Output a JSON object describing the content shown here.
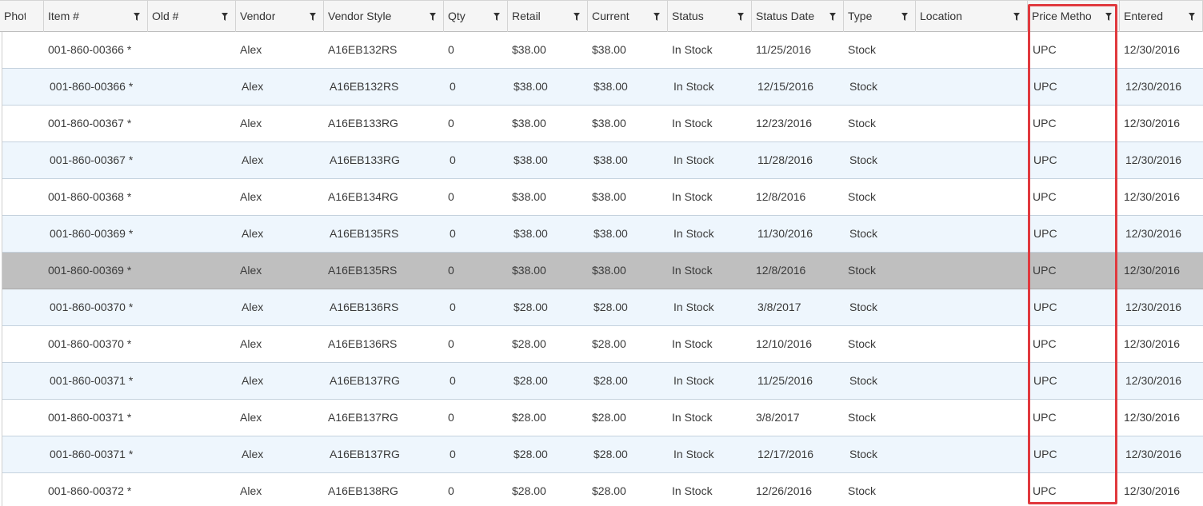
{
  "columns": [
    {
      "key": "photo",
      "label": "Photo",
      "filter": false
    },
    {
      "key": "item",
      "label": "Item #",
      "filter": true
    },
    {
      "key": "old",
      "label": "Old #",
      "filter": true
    },
    {
      "key": "vendor",
      "label": "Vendor",
      "filter": true
    },
    {
      "key": "vendor_style",
      "label": "Vendor Style",
      "filter": true
    },
    {
      "key": "qty",
      "label": "Qty",
      "filter": true
    },
    {
      "key": "retail",
      "label": "Retail",
      "filter": true
    },
    {
      "key": "current",
      "label": "Current",
      "filter": true
    },
    {
      "key": "status",
      "label": "Status",
      "filter": true
    },
    {
      "key": "status_date",
      "label": "Status Date",
      "filter": true
    },
    {
      "key": "type",
      "label": "Type",
      "filter": true
    },
    {
      "key": "location",
      "label": "Location",
      "filter": true
    },
    {
      "key": "price_method",
      "label": "Price Metho",
      "filter": true
    },
    {
      "key": "entered",
      "label": "Entered",
      "filter": true
    }
  ],
  "rows": [
    {
      "item": "001-860-00366 *",
      "vendor": "Alex",
      "vendor_style": "A16EB132RS",
      "qty": "0",
      "retail": "$38.00",
      "current": "$38.00",
      "status": "In Stock",
      "status_date": "11/25/2016",
      "type": "Stock",
      "price_method": "UPC",
      "entered": "12/30/2016",
      "selected": false
    },
    {
      "item": "001-860-00366 *",
      "vendor": "Alex",
      "vendor_style": "A16EB132RS",
      "qty": "0",
      "retail": "$38.00",
      "current": "$38.00",
      "status": "In Stock",
      "status_date": "12/15/2016",
      "type": "Stock",
      "price_method": "UPC",
      "entered": "12/30/2016",
      "selected": false
    },
    {
      "item": "001-860-00367 *",
      "vendor": "Alex",
      "vendor_style": "A16EB133RG",
      "qty": "0",
      "retail": "$38.00",
      "current": "$38.00",
      "status": "In Stock",
      "status_date": "12/23/2016",
      "type": "Stock",
      "price_method": "UPC",
      "entered": "12/30/2016",
      "selected": false
    },
    {
      "item": "001-860-00367 *",
      "vendor": "Alex",
      "vendor_style": "A16EB133RG",
      "qty": "0",
      "retail": "$38.00",
      "current": "$38.00",
      "status": "In Stock",
      "status_date": "11/28/2016",
      "type": "Stock",
      "price_method": "UPC",
      "entered": "12/30/2016",
      "selected": false
    },
    {
      "item": "001-860-00368 *",
      "vendor": "Alex",
      "vendor_style": "A16EB134RG",
      "qty": "0",
      "retail": "$38.00",
      "current": "$38.00",
      "status": "In Stock",
      "status_date": "12/8/2016",
      "type": "Stock",
      "price_method": "UPC",
      "entered": "12/30/2016",
      "selected": false
    },
    {
      "item": "001-860-00369 *",
      "vendor": "Alex",
      "vendor_style": "A16EB135RS",
      "qty": "0",
      "retail": "$38.00",
      "current": "$38.00",
      "status": "In Stock",
      "status_date": "11/30/2016",
      "type": "Stock",
      "price_method": "UPC",
      "entered": "12/30/2016",
      "selected": false
    },
    {
      "item": "001-860-00369 *",
      "vendor": "Alex",
      "vendor_style": "A16EB135RS",
      "qty": "0",
      "retail": "$38.00",
      "current": "$38.00",
      "status": "In Stock",
      "status_date": "12/8/2016",
      "type": "Stock",
      "price_method": "UPC",
      "entered": "12/30/2016",
      "selected": true
    },
    {
      "item": "001-860-00370 *",
      "vendor": "Alex",
      "vendor_style": "A16EB136RS",
      "qty": "0",
      "retail": "$28.00",
      "current": "$28.00",
      "status": "In Stock",
      "status_date": "3/8/2017",
      "type": "Stock",
      "price_method": "UPC",
      "entered": "12/30/2016",
      "selected": false
    },
    {
      "item": "001-860-00370 *",
      "vendor": "Alex",
      "vendor_style": "A16EB136RS",
      "qty": "0",
      "retail": "$28.00",
      "current": "$28.00",
      "status": "In Stock",
      "status_date": "12/10/2016",
      "type": "Stock",
      "price_method": "UPC",
      "entered": "12/30/2016",
      "selected": false
    },
    {
      "item": "001-860-00371 *",
      "vendor": "Alex",
      "vendor_style": "A16EB137RG",
      "qty": "0",
      "retail": "$28.00",
      "current": "$28.00",
      "status": "In Stock",
      "status_date": "11/25/2016",
      "type": "Stock",
      "price_method": "UPC",
      "entered": "12/30/2016",
      "selected": false
    },
    {
      "item": "001-860-00371 *",
      "vendor": "Alex",
      "vendor_style": "A16EB137RG",
      "qty": "0",
      "retail": "$28.00",
      "current": "$28.00",
      "status": "In Stock",
      "status_date": "3/8/2017",
      "type": "Stock",
      "price_method": "UPC",
      "entered": "12/30/2016",
      "selected": false
    },
    {
      "item": "001-860-00371 *",
      "vendor": "Alex",
      "vendor_style": "A16EB137RG",
      "qty": "0",
      "retail": "$28.00",
      "current": "$28.00",
      "status": "In Stock",
      "status_date": "12/17/2016",
      "type": "Stock",
      "price_method": "UPC",
      "entered": "12/30/2016",
      "selected": false
    },
    {
      "item": "001-860-00372 *",
      "vendor": "Alex",
      "vendor_style": "A16EB138RG",
      "qty": "0",
      "retail": "$28.00",
      "current": "$28.00",
      "status": "In Stock",
      "status_date": "12/26/2016",
      "type": "Stock",
      "price_method": "UPC",
      "entered": "12/30/2016",
      "selected": false
    }
  ],
  "colors": {
    "header_bg": "#f5f5f5",
    "row_even": "#ffffff",
    "row_odd": "#eef6fd",
    "row_selected": "#bfbfbf",
    "highlight_box": "#e0393e"
  },
  "icons": {
    "filter": "funnel-filter-icon"
  }
}
